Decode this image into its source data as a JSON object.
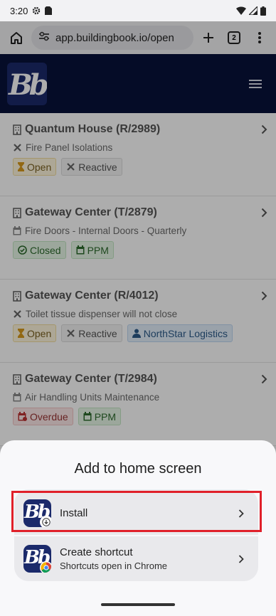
{
  "status_bar": {
    "time": "3:20"
  },
  "browser": {
    "url": "app.buildingbook.io/open",
    "tab_count": "2"
  },
  "site": {
    "logo_text": "Bb"
  },
  "jobs": [
    {
      "title": "Quantum House (R/2989)",
      "subtitle": "Fire Panel Isolations",
      "status": "Open",
      "type": "Reactive"
    },
    {
      "title": "Gateway Center (T/2879)",
      "subtitle": "Fire Doors - Internal Doors - Quarterly",
      "status": "Closed",
      "type": "PPM"
    },
    {
      "title": "Gateway Center (R/4012)",
      "subtitle": "Toilet tissue dispenser will not close",
      "status": "Open",
      "type": "Reactive",
      "company": "NorthStar Logistics"
    },
    {
      "title": "Gateway Center (T/2984)",
      "subtitle": "Air Handling Units Maintenance",
      "status": "Overdue",
      "type": "PPM"
    }
  ],
  "sheet": {
    "title": "Add to home screen",
    "install": {
      "label": "Install"
    },
    "shortcut": {
      "label": "Create shortcut",
      "sub": "Shortcuts open in Chrome"
    }
  },
  "colors": {
    "header_bg": "#08123a",
    "highlight": "#e0202a"
  }
}
